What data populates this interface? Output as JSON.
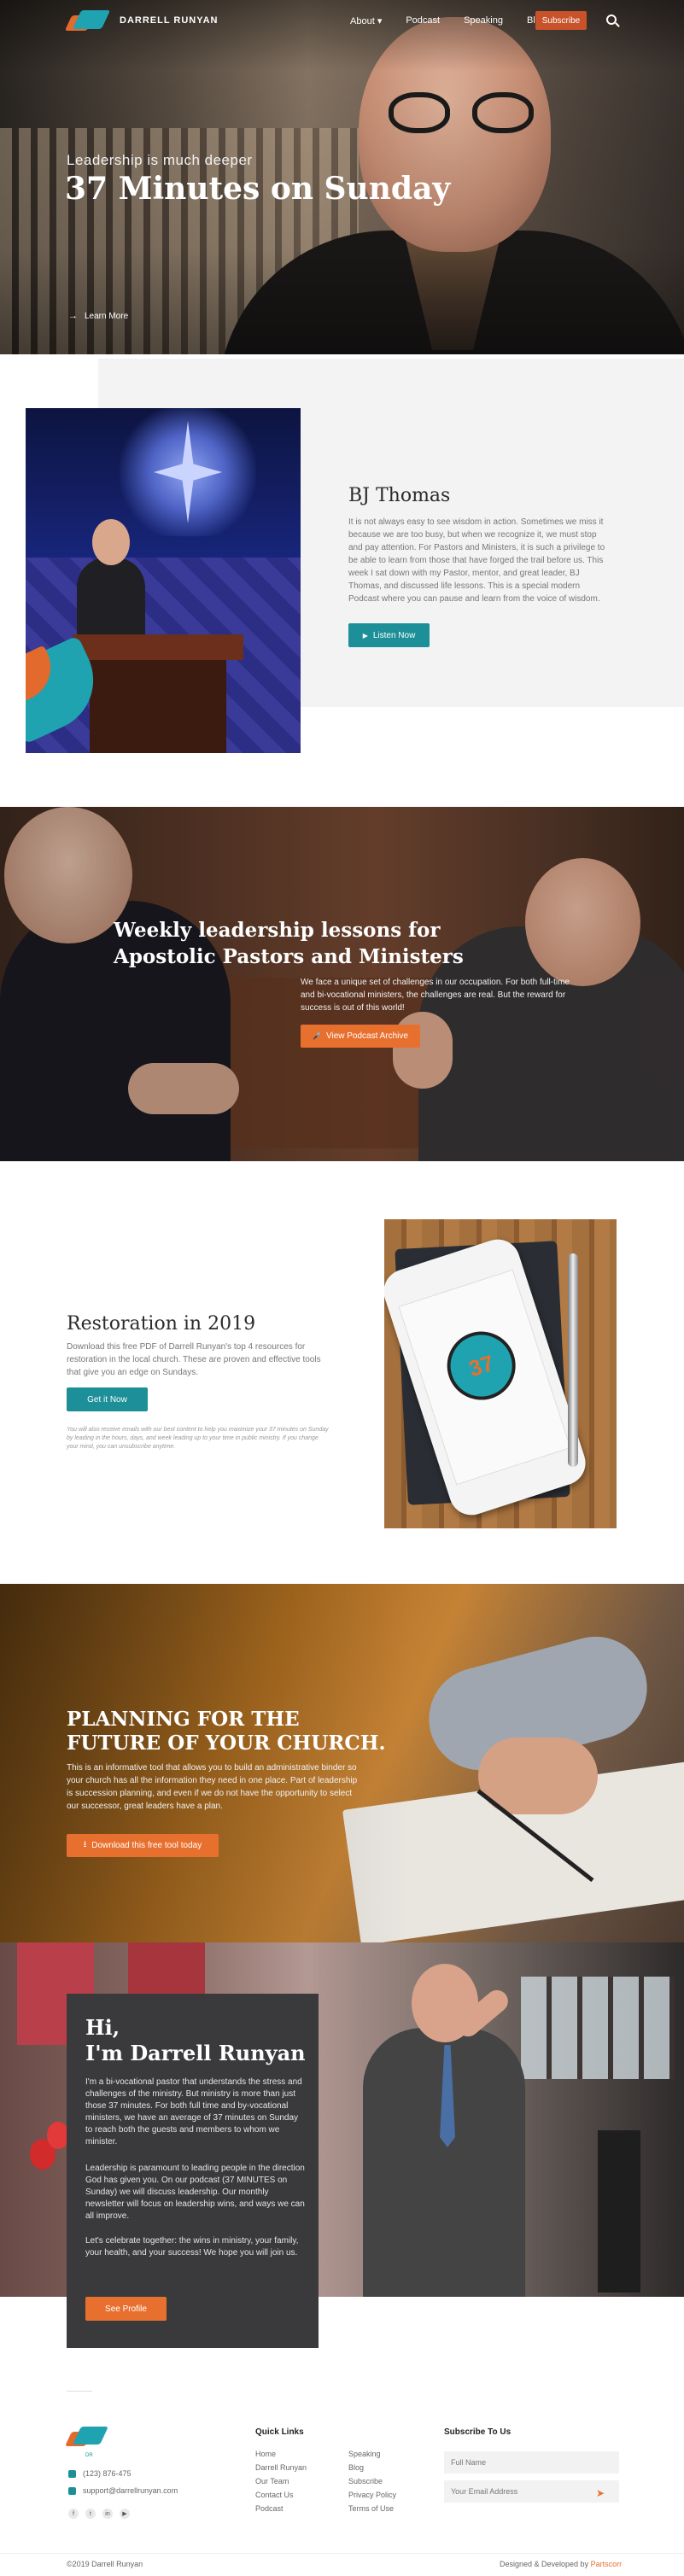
{
  "brand": {
    "name": "DARRELL RUNYAN"
  },
  "nav": {
    "items": [
      "About",
      "Podcast",
      "Speaking",
      "Blog"
    ],
    "about_caret": "▾",
    "subscribe": "Subscribe"
  },
  "hero": {
    "subtitle": "Leadership is much deeper",
    "title": "37 Minutes on Sunday",
    "learn_more": "Learn More",
    "arrow": "→"
  },
  "bj": {
    "title": "BJ Thomas",
    "text": "It is not always easy to see wisdom in action. Sometimes we miss it because we are too busy, but when we recognize it, we must stop and pay attention. For Pastors and Ministers, it is such a privilege to be able to learn from those that have forged the trail before us. This week I sat down with my Pastor, mentor, and great leader, BJ Thomas, and discussed life lessons. This is a special modern Podcast where you can pause and learn from the voice of wisdom.",
    "button": "Listen Now",
    "button_icon": "▶"
  },
  "weekly": {
    "title": "Weekly leadership lessons for Apostolic Pastors and Ministers",
    "text": "We face a unique set of challenges in our occupation. For both full-time and bi-vocational ministers, the challenges are real. But the reward for success is out of this world!",
    "button": "View Podcast Archive",
    "button_icon": "🎤"
  },
  "restoration": {
    "title": "Restoration in 2019",
    "text": "Download this free PDF of Darrell Runyan's top 4 resources for restoration in the local church. These are proven and effective tools that give you an edge on Sundays.",
    "button": "Get it Now",
    "fine_print": "You will also receive emails with our best content to help you maximize your 37 minutes on Sunday by leading in the hours, days, and week leading up to your time in public ministry. If you change your mind, you can unsubscribe anytime.",
    "badge_number": "37"
  },
  "planning": {
    "title": "PLANNING FOR THE FUTURE OF YOUR CHURCH.",
    "text": "This is an informative tool that allows you to build an administrative binder so your church has all the information they need in one place. Part of leadership is succession planning, and even if we do not have the opportunity to select our successor, great leaders have a plan.",
    "button": "Download this free tool today",
    "button_icon": "⭳"
  },
  "about": {
    "hi": "Hi,",
    "name": "I'm Darrell Runyan",
    "p1": "I'm a bi-vocational pastor that understands the stress and challenges of the ministry. But ministry is more than just those 37 minutes. For both full time and by-vocational ministers, we have an average of 37 minutes on Sunday to reach both the guests and members to whom we minister.",
    "p2": "Leadership is paramount to leading people in the direction God has given you. On our podcast (37 MINUTES on Sunday) we will discuss leadership. Our monthly newsletter will focus on leadership wins, and ways we can all improve.",
    "p3": "Let's celebrate together: the wins in ministry, your family, your health, and your success! We hope you will join us.",
    "button": "See Profile"
  },
  "footer": {
    "logo_text": "DR",
    "phone": "(123) 876-475",
    "email": "support@darrellrunyan.com",
    "social": [
      "f",
      "t",
      "in",
      "▶"
    ],
    "quick_links_title": "Quick Links",
    "col1": [
      "Home",
      "Darrell Runyan",
      "Our Team",
      "Contact Us",
      "Podcast"
    ],
    "col2": [
      "Speaking",
      "Blog",
      "Subscribe",
      "Privacy Policy",
      "Terms of Use"
    ],
    "subscribe_title": "Subscribe To Us",
    "name_placeholder": "Full Name",
    "email_placeholder": "Your Email Address",
    "send_icon": "➤",
    "copyright": "©2019 Darrell Runyan",
    "designed_by": "Designed & Developed by",
    "designer": "Partscorr"
  }
}
